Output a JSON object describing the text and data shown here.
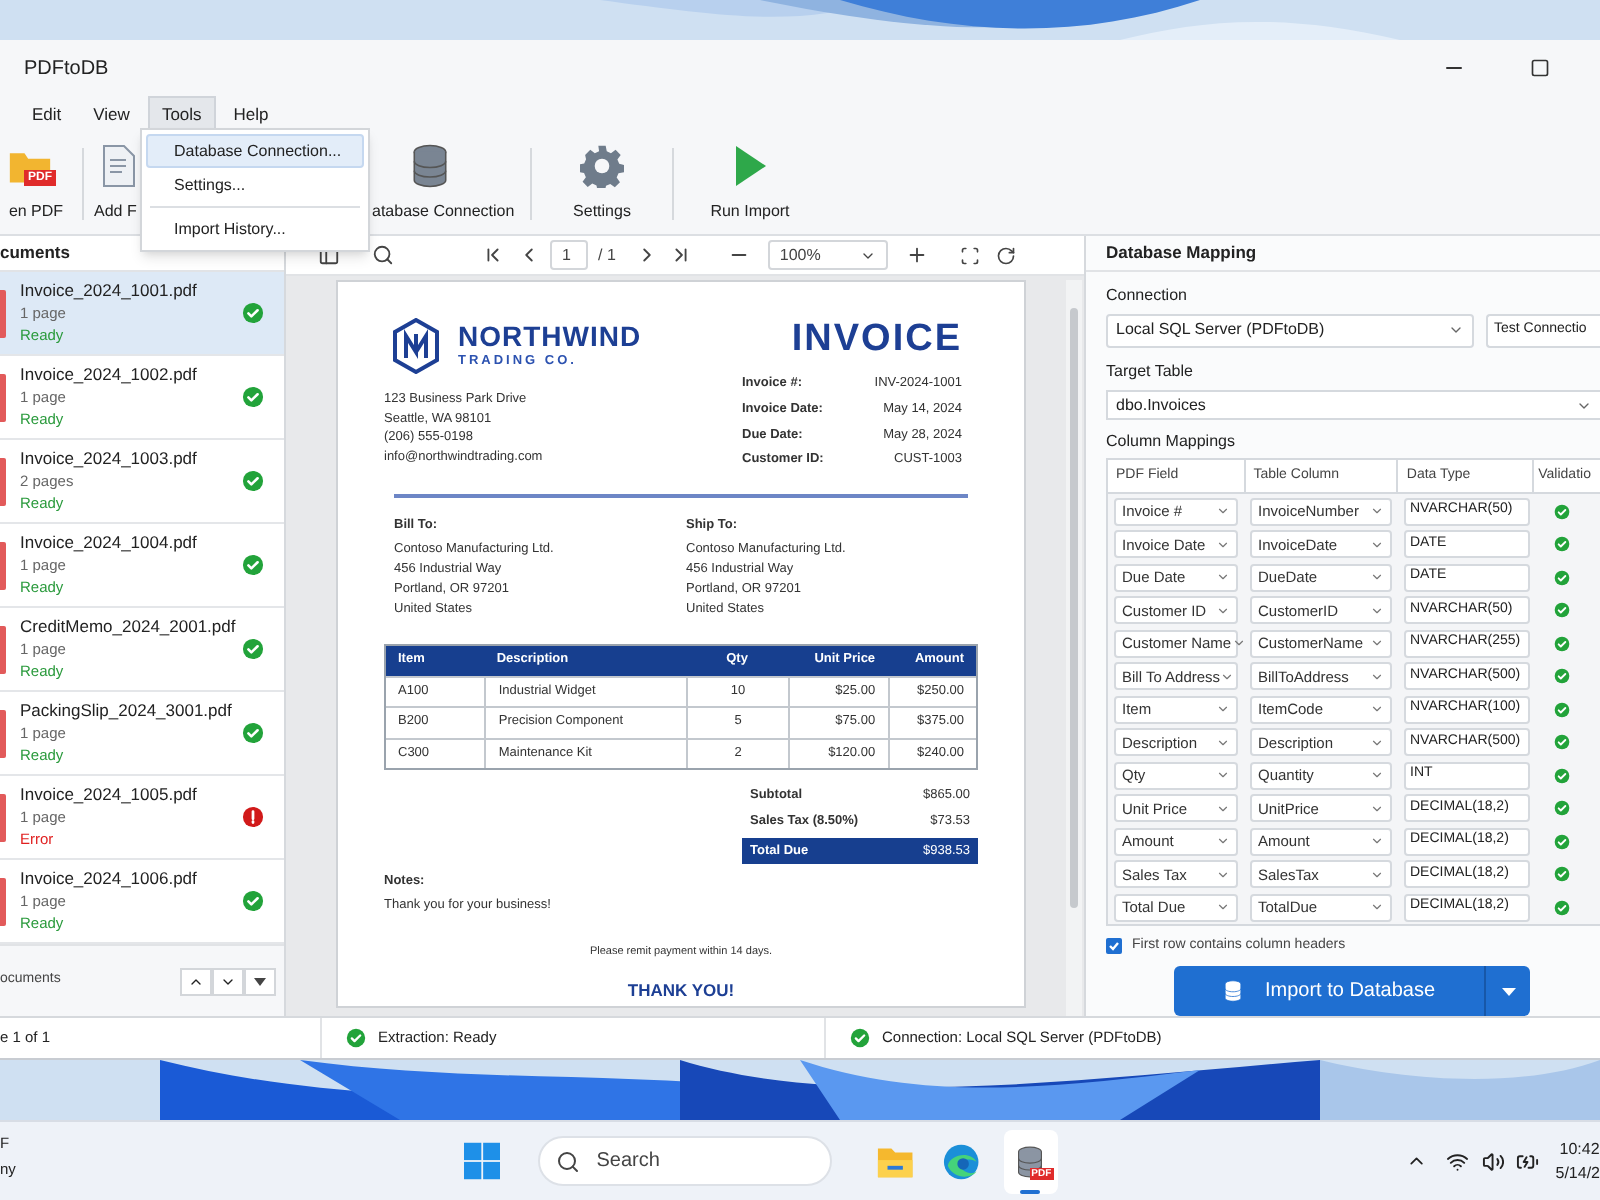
{
  "window": {
    "title": "PDFtoDB"
  },
  "menu": [
    {
      "label": "Edit",
      "selected": false
    },
    {
      "label": "View",
      "selected": false
    },
    {
      "label": "Tools",
      "selected": true
    },
    {
      "label": "Help",
      "selected": false
    }
  ],
  "dropdown": [
    {
      "kind": "item",
      "label": "Database Connection...",
      "selected": true
    },
    {
      "kind": "item",
      "label": "Settings...",
      "selected": false
    },
    {
      "kind": "separator"
    },
    {
      "kind": "item",
      "label": "Import History...",
      "selected": false
    }
  ],
  "toolbar": [
    {
      "kind": "open",
      "label": "en PDF",
      "badge": "PDF"
    },
    {
      "kind": "add",
      "label": "Add F"
    },
    {
      "kind": "database",
      "label": "atabase Connection"
    },
    {
      "kind": "settings",
      "label": "Settings"
    },
    {
      "kind": "run",
      "label": "Run Import"
    }
  ],
  "documents": {
    "title": "cuments",
    "footer": "ocuments",
    "items": [
      {
        "name": "Invoice_2024_1001.pdf",
        "pages": "1 page",
        "status": "Ready",
        "kind": "ready",
        "selected": true
      },
      {
        "name": "Invoice_2024_1002.pdf",
        "pages": "1 page",
        "status": "Ready",
        "kind": "ready",
        "selected": false
      },
      {
        "name": "Invoice_2024_1003.pdf",
        "pages": "2 pages",
        "status": "Ready",
        "kind": "ready",
        "selected": false
      },
      {
        "name": "Invoice_2024_1004.pdf",
        "pages": "1 page",
        "status": "Ready",
        "kind": "ready",
        "selected": false
      },
      {
        "name": "CreditMemo_2024_2001.pdf",
        "pages": "1 page",
        "status": "Ready",
        "kind": "ready",
        "selected": false
      },
      {
        "name": "PackingSlip_2024_3001.pdf",
        "pages": "1 page",
        "status": "Ready",
        "kind": "ready",
        "selected": false
      },
      {
        "name": "Invoice_2024_1005.pdf",
        "pages": "1 page",
        "status": "Error",
        "kind": "error",
        "selected": false
      },
      {
        "name": "Invoice_2024_1006.pdf",
        "pages": "1 page",
        "status": "Ready",
        "kind": "ready",
        "selected": false
      }
    ]
  },
  "viewer": {
    "page": "1",
    "page_count": "/ 1",
    "zoom": "100%"
  },
  "invoice": {
    "company": "NORTHWIND",
    "company_sub": "TRADING CO.",
    "address": [
      "123 Business Park Drive",
      "Seattle, WA 98101",
      "(206) 555-0198",
      "info@northwindtrading.com"
    ],
    "title": "INVOICE",
    "meta": [
      {
        "label": "Invoice #:",
        "value": "INV-2024-1001"
      },
      {
        "label": "Invoice Date:",
        "value": "May 14, 2024"
      },
      {
        "label": "Due Date:",
        "value": "May 28, 2024"
      },
      {
        "label": "Customer ID:",
        "value": "CUST-1003"
      }
    ],
    "parties": [
      {
        "title": "Bill To:",
        "lines": [
          "Contoso Manufacturing Ltd.",
          "456 Industrial Way",
          "Portland, OR 97201",
          "United States"
        ]
      },
      {
        "title": "Ship To:",
        "lines": [
          "Contoso Manufacturing Ltd.",
          "456 Industrial Way",
          "Portland, OR 97201",
          "United States"
        ]
      }
    ],
    "columns": [
      "Item",
      "Description",
      "Qty",
      "Unit Price",
      "Amount"
    ],
    "rows": [
      [
        "A100",
        "Industrial Widget",
        "10",
        "$25.00",
        "$250.00"
      ],
      [
        "B200",
        "Precision Component",
        "5",
        "$75.00",
        "$375.00"
      ],
      [
        "C300",
        "Maintenance Kit",
        "2",
        "$120.00",
        "$240.00"
      ]
    ],
    "totals": [
      {
        "kind": "plain",
        "label": "Subtotal",
        "value": "$865.00"
      },
      {
        "kind": "plain",
        "label": "Sales Tax (8.50%)",
        "value": "$73.53"
      },
      {
        "kind": "total",
        "label": "Total Due",
        "value": "$938.53"
      }
    ],
    "notes_title": "Notes:",
    "notes": "Thank you for your business!",
    "remit": "Please remit payment within 14 days.",
    "thanks": "THANK YOU!"
  },
  "mapping": {
    "title": "Database Mapping",
    "connection_label": "Connection",
    "connection": "Local SQL Server (PDFtoDB)",
    "test_button": "Test Connectio",
    "target_label": "Target Table",
    "target": "dbo.Invoices",
    "mappings_label": "Column Mappings",
    "columns": [
      "PDF Field",
      "Table Column",
      "Data Type",
      "Validatio"
    ],
    "rows": [
      {
        "pdf_field": "Invoice #",
        "table_column": "InvoiceNumber",
        "data_type": "NVARCHAR(50)",
        "valid": true
      },
      {
        "pdf_field": "Invoice Date",
        "table_column": "InvoiceDate",
        "data_type": "DATE",
        "valid": true
      },
      {
        "pdf_field": "Due Date",
        "table_column": "DueDate",
        "data_type": "DATE",
        "valid": true
      },
      {
        "pdf_field": "Customer ID",
        "table_column": "CustomerID",
        "data_type": "NVARCHAR(50)",
        "valid": true
      },
      {
        "pdf_field": "Customer Name",
        "table_column": "CustomerName",
        "data_type": "NVARCHAR(255)",
        "valid": true
      },
      {
        "pdf_field": "Bill To Address",
        "table_column": "BillToAddress",
        "data_type": "NVARCHAR(500)",
        "valid": true
      },
      {
        "pdf_field": "Item",
        "table_column": "ItemCode",
        "data_type": "NVARCHAR(100)",
        "valid": true
      },
      {
        "pdf_field": "Description",
        "table_column": "Description",
        "data_type": "NVARCHAR(500)",
        "valid": true
      },
      {
        "pdf_field": "Qty",
        "table_column": "Quantity",
        "data_type": "INT",
        "valid": true
      },
      {
        "pdf_field": "Unit Price",
        "table_column": "UnitPrice",
        "data_type": "DECIMAL(18,2)",
        "valid": true
      },
      {
        "pdf_field": "Amount",
        "table_column": "Amount",
        "data_type": "DECIMAL(18,2)",
        "valid": true
      },
      {
        "pdf_field": "Sales Tax",
        "table_column": "SalesTax",
        "data_type": "DECIMAL(18,2)",
        "valid": true
      },
      {
        "pdf_field": "Total Due",
        "table_column": "TotalDue",
        "data_type": "DECIMAL(18,2)",
        "valid": true
      }
    ],
    "header_checkbox": {
      "label": "First row contains column headers",
      "checked": true
    },
    "import_button": "Import to Database"
  },
  "status_bar": [
    {
      "kind": "plain",
      "text": "e 1 of 1"
    },
    {
      "kind": "ok",
      "text": "Extraction: Ready"
    },
    {
      "kind": "ok",
      "text": "Connection: Local SQL Server (PDFtoDB)"
    }
  ],
  "taskbar": {
    "weather": [
      "F",
      "ny"
    ],
    "search": "Search",
    "app_badge": "PDF",
    "time": "10:42",
    "date": "5/14/2"
  }
}
